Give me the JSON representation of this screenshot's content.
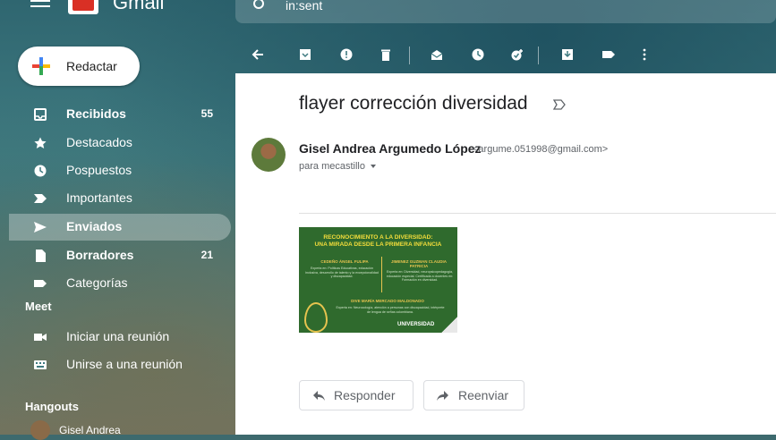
{
  "header": {
    "brand": "Gmail",
    "search_value": "in:sent"
  },
  "compose": {
    "label": "Redactar"
  },
  "sidebar": {
    "items": [
      {
        "label": "Recibidos",
        "count": "55",
        "icon": "inbox-icon"
      },
      {
        "label": "Destacados",
        "count": "",
        "icon": "star-icon"
      },
      {
        "label": "Pospuestos",
        "count": "",
        "icon": "clock-icon"
      },
      {
        "label": "Importantes",
        "count": "",
        "icon": "important-icon"
      },
      {
        "label": "Enviados",
        "count": "",
        "icon": "send-icon"
      },
      {
        "label": "Borradores",
        "count": "21",
        "icon": "draft-icon"
      },
      {
        "label": "Categorías",
        "count": "",
        "icon": "label-icon"
      }
    ],
    "meet": {
      "title": "Meet",
      "items": [
        {
          "label": "Iniciar una reunión",
          "icon": "video-icon"
        },
        {
          "label": "Unirse a una reunión",
          "icon": "keyboard-icon"
        }
      ]
    },
    "hangouts": {
      "title": "Hangouts",
      "contact": "Gisel Andrea"
    }
  },
  "email": {
    "subject": "flayer corrección diversidad",
    "sender_name": "Gisel Andrea Argumedo López",
    "sender_email": "<argume.051998@gmail.com>",
    "recipient": "para mecastillo",
    "attachment": {
      "title_line1": "RECONOCIMIENTO A LA DIVERSIDAD:",
      "title_line2": "UNA MIRADA DESDE LA PRIMERA INFANCIA",
      "name1": "CEDEÑO ÁNGEL FULIPA",
      "desc1": "Experta en: Políticas Educativas, educación inclusiva, desarrollo de talento y la excepcionalidad y discapacidad.",
      "name2": "JIMENEZ GUZMAN CLAUDIA PATRICIA",
      "desc2": "Experta en: Diversidad, neuropsicopedagogía, educación especial. Certificada a docentes en: Formación en diversidad.",
      "name3": "DIVE MARÍA MERCADO MALDONADO",
      "desc3": "Experta en: Neurocología, atención a personas con discapacidad, intérprete de lengua de señas colombiana.",
      "footer": "UNIVERSIDAD"
    },
    "actions": {
      "reply": "Responder",
      "forward": "Reenviar"
    }
  },
  "colors": {
    "accent": "#d93025",
    "attachment_bg": "#2f6a2d"
  }
}
